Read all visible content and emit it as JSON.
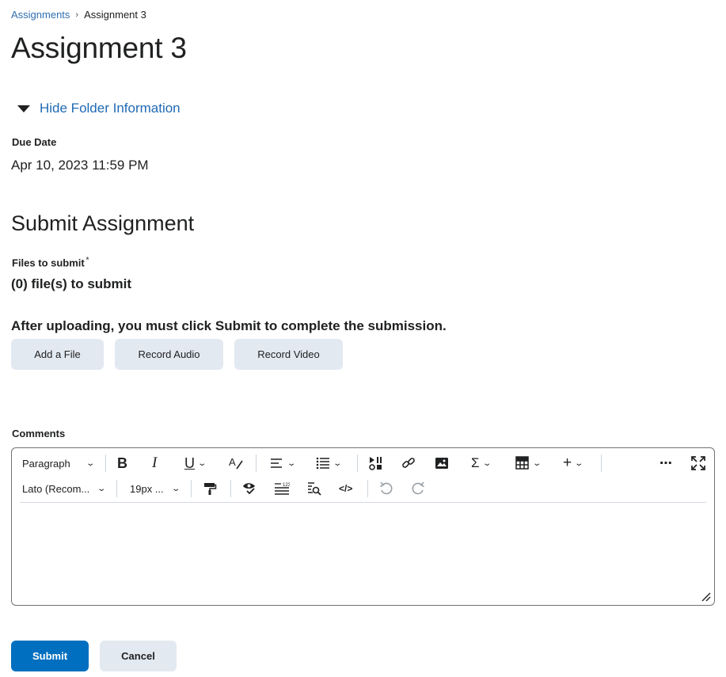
{
  "breadcrumb": {
    "parent": "Assignments",
    "separator": "›",
    "current": "Assignment 3"
  },
  "page_title": "Assignment 3",
  "folder_toggle": {
    "label": "Hide Folder Information",
    "icon": "caret-down-icon"
  },
  "due": {
    "label": "Due Date",
    "value": "Apr 10, 2023 11:59 PM"
  },
  "submit_section": {
    "title": "Submit Assignment",
    "files_label": "Files to submit",
    "required_mark": "*",
    "files_count": "(0) file(s) to submit",
    "note": "After uploading, you must click Submit to complete the submission.",
    "buttons": {
      "add_file": "Add a File",
      "record_audio": "Record Audio",
      "record_video": "Record Video"
    }
  },
  "comments": {
    "label": "Comments",
    "toolbar": {
      "block_format": "Paragraph",
      "font_family": "Lato (Recom...",
      "font_size": "19px ...",
      "icons": [
        "bold-icon",
        "italic-icon",
        "underline-icon",
        "text-color-icon",
        "align-icon",
        "bullet-list-icon",
        "insert-stuff-icon",
        "link-icon",
        "image-icon",
        "equation-icon",
        "table-icon",
        "insert-more-icon",
        "more-actions-icon",
        "fullscreen-icon",
        "format-painter-icon",
        "accessibility-checker-icon",
        "word-count-icon",
        "find-replace-icon",
        "source-code-icon",
        "undo-icon",
        "redo-icon"
      ]
    }
  },
  "actions": {
    "submit": "Submit",
    "cancel": "Cancel"
  },
  "colors": {
    "link": "#1f6ab4",
    "primary": "#006fbf",
    "secondary_button": "#e3e9f1",
    "text": "#202122"
  }
}
